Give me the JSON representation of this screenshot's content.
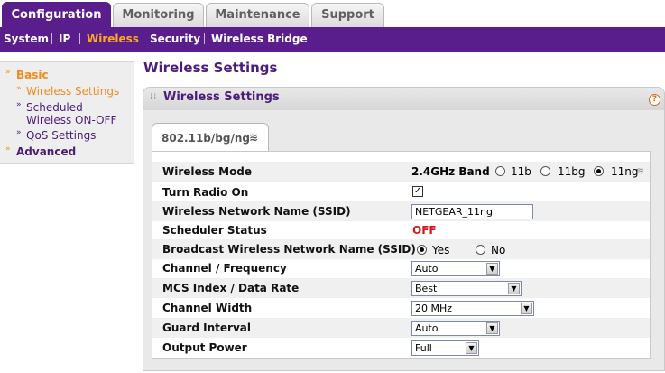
{
  "top_tabs": [
    "Configuration",
    "Monitoring",
    "Maintenance",
    "Support"
  ],
  "subnav": [
    "System",
    "IP",
    "Wireless",
    "Security",
    "Wireless Bridge"
  ],
  "left_menu": {
    "basic": "Basic",
    "items": [
      "Wireless Settings",
      "Scheduled Wireless ON-OFF",
      "QoS Settings"
    ],
    "advanced": "Advanced"
  },
  "page_title": "Wireless Settings",
  "panel": {
    "title": "Wireless Settings",
    "mode_tab": "802.11b/bg/ng"
  },
  "fields": {
    "wireless_mode": {
      "label": "Wireless Mode",
      "band": "2.4GHz Band",
      "options": [
        "11b",
        "11bg",
        "11ng"
      ],
      "selected": "11ng"
    },
    "turn_radio_on": {
      "label": "Turn Radio On",
      "checked": true
    },
    "ssid": {
      "label": "Wireless Network Name (SSID)",
      "value": "NETGEAR_11ng"
    },
    "scheduler_status": {
      "label": "Scheduler Status",
      "value": "OFF"
    },
    "broadcast_ssid": {
      "label": "Broadcast Wireless Network Name (SSID)",
      "options": [
        "Yes",
        "No"
      ],
      "selected": "Yes"
    },
    "channel": {
      "label": "Channel / Frequency",
      "value": "Auto"
    },
    "mcs": {
      "label": "MCS Index / Data Rate",
      "value": "Best"
    },
    "channel_width": {
      "label": "Channel Width",
      "value": "20 MHz"
    },
    "guard_interval": {
      "label": "Guard Interval",
      "value": "Auto"
    },
    "output_power": {
      "label": "Output Power",
      "value": "Full"
    }
  },
  "colors": {
    "brand_purple": "#5a1e8c",
    "accent_orange": "#ffa726",
    "off_red": "#d4181a"
  }
}
